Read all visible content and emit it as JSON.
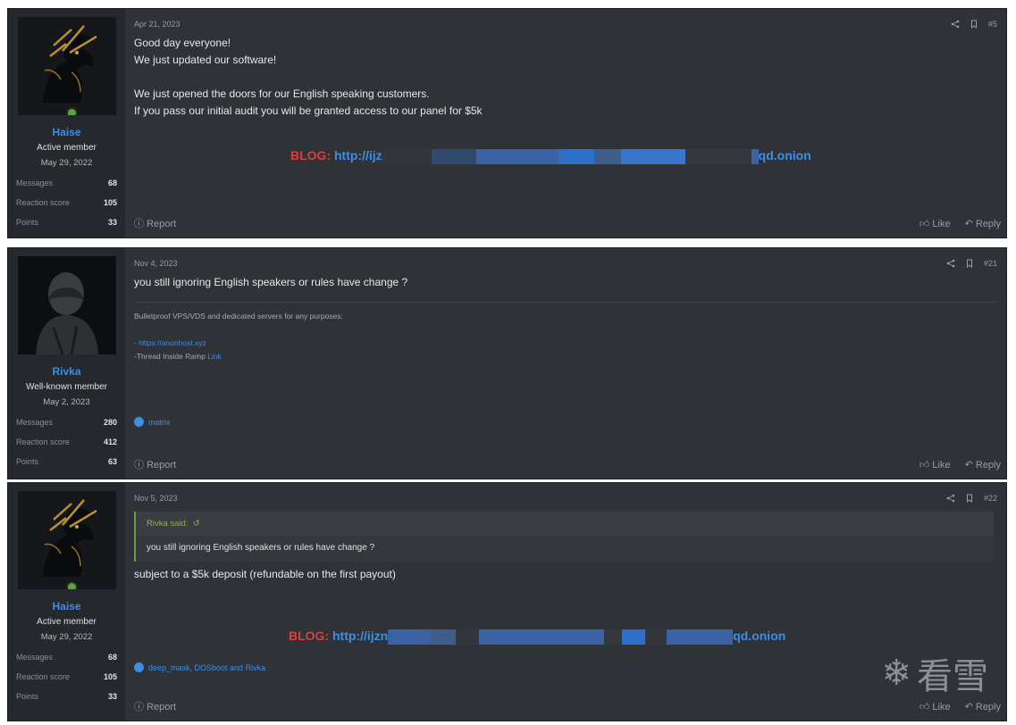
{
  "posts": [
    {
      "user": {
        "name": "Haise",
        "title": "Active member",
        "joined": "May 29, 2022",
        "stats": [
          {
            "label": "Messages",
            "value": "68"
          },
          {
            "label": "Reaction score",
            "value": "105"
          },
          {
            "label": "Points",
            "value": "33"
          }
        ]
      },
      "date": "Apr 21, 2023",
      "post_number": "#5",
      "body": [
        "Good day everyone!",
        "We just updated our software!",
        "",
        "We just opened the doors for our English speaking customers.",
        "If you pass our initial audit you will be granted access to our panel for $5k"
      ],
      "blog_label": "BLOG:",
      "blog_url_start": "http://ijz",
      "blog_url_end": "qd.onion",
      "report": "Report",
      "like": "Like",
      "reply": "Reply"
    },
    {
      "user": {
        "name": "Rivka",
        "title": "Well-known member",
        "joined": "May 2, 2023",
        "stats": [
          {
            "label": "Messages",
            "value": "280"
          },
          {
            "label": "Reaction score",
            "value": "412"
          },
          {
            "label": "Points",
            "value": "63"
          }
        ]
      },
      "date": "Nov 4, 2023",
      "post_number": "#21",
      "body": [
        "you still ignoring English speakers or rules have change ?"
      ],
      "signature": {
        "line1": "Bulletproof VPS/VDS and dedicated servers for any purposes:",
        "link1": "- https://anonhost.xyz",
        "line3_text": "-Thread Inside Ramp",
        "line3_link": "Link"
      },
      "reactions": "matrix",
      "report": "Report",
      "like": "Like",
      "reply": "Reply"
    },
    {
      "user": {
        "name": "Haise",
        "title": "Active member",
        "joined": "May 29, 2022",
        "stats": [
          {
            "label": "Messages",
            "value": "68"
          },
          {
            "label": "Reaction score",
            "value": "105"
          },
          {
            "label": "Points",
            "value": "33"
          }
        ]
      },
      "date": "Nov 5, 2023",
      "post_number": "#22",
      "quote": {
        "author": "Rivka said:",
        "text": "you still ignoring English speakers or rules have change ?"
      },
      "body": [
        "subject to a $5k deposit (refundable on the first payout)"
      ],
      "blog_label": "BLOG:",
      "blog_url_start": "http://ijzn",
      "blog_url_end": "qd.onion",
      "reactions": "deep_mask, DOSboot and Rivka",
      "report": "Report",
      "like": "Like",
      "reply": "Reply"
    }
  ],
  "watermark": {
    "glyph": "❄",
    "text": "看雪"
  },
  "colors": {
    "post_bg": "#2f3237",
    "user_col_bg": "#25282c",
    "username": "#3d8ee5",
    "blog_label": "#d9403f",
    "link": "#3d8ee5",
    "quote_author": "#8fae54"
  },
  "icons": {
    "share": "share-icon",
    "bookmark": "bookmark-icon",
    "report": "report-icon",
    "like": "thumbs-up-icon",
    "reply": "reply-arrow-icon",
    "reaction": "like-reaction-icon",
    "quote_jump": "jump-arrow-icon"
  }
}
